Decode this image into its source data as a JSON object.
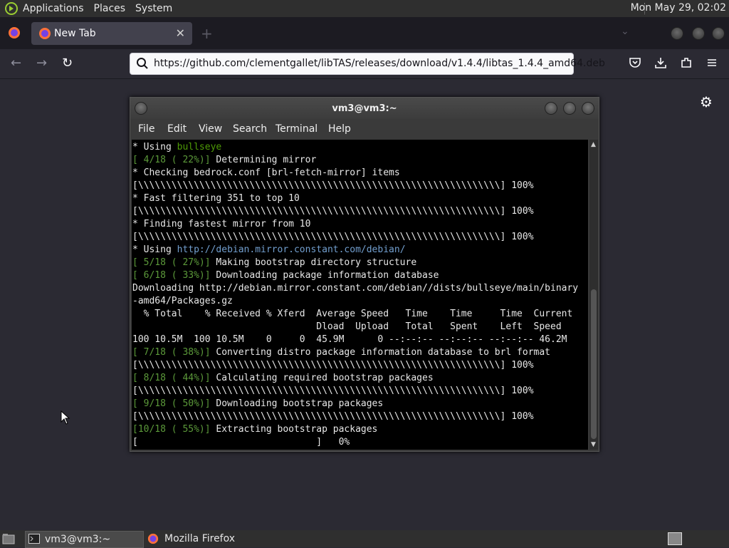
{
  "top_panel": {
    "menus": [
      "Applications",
      "Places",
      "System"
    ],
    "clock": "Mon May 29, 02:02"
  },
  "browser": {
    "tab": {
      "title": "New Tab",
      "close": "✕"
    },
    "new_tab": "+",
    "url": "https://github.com/clementgallet/libTAS/releases/download/v1.4.4/libtas_1.4.4_amd64.deb"
  },
  "terminal": {
    "title": "vm3@vm3:~",
    "menu": [
      "File",
      "Edit",
      "View",
      "Search",
      "Terminal",
      "Help"
    ],
    "lines": [
      [
        {
          "t": "* Using ",
          "c": ""
        },
        {
          "t": "bullseye",
          "c": "g"
        }
      ],
      [
        {
          "t": "[ 4/18 ( 22%)]",
          "c": "g2"
        },
        {
          "t": " Determining mirror",
          "c": ""
        }
      ],
      [
        {
          "t": "* Checking bedrock.conf [brl-fetch-mirror] items",
          "c": ""
        }
      ],
      [
        {
          "t": "[\\\\\\\\\\\\\\\\\\\\\\\\\\\\\\\\\\\\\\\\\\\\\\\\\\\\\\\\\\\\\\\\\\\\\\\\\\\\\\\\\\\\\\\\\\\\\\\\\\\\\\\\\\\\\\\\\\\\\\\\\\\\\\\\\\] 100%",
          "c": ""
        }
      ],
      [
        {
          "t": "* Fast filtering 351 to top 10",
          "c": ""
        }
      ],
      [
        {
          "t": "[\\\\\\\\\\\\\\\\\\\\\\\\\\\\\\\\\\\\\\\\\\\\\\\\\\\\\\\\\\\\\\\\\\\\\\\\\\\\\\\\\\\\\\\\\\\\\\\\\\\\\\\\\\\\\\\\\\\\\\\\\\\\\\\\\\] 100%",
          "c": ""
        }
      ],
      [
        {
          "t": "* Finding fastest mirror from 10",
          "c": ""
        }
      ],
      [
        {
          "t": "[\\\\\\\\\\\\\\\\\\\\\\\\\\\\\\\\\\\\\\\\\\\\\\\\\\\\\\\\\\\\\\\\\\\\\\\\\\\\\\\\\\\\\\\\\\\\\\\\\\\\\\\\\\\\\\\\\\\\\\\\\\\\\\\\\\] 100%",
          "c": ""
        }
      ],
      [
        {
          "t": "* Using ",
          "c": ""
        },
        {
          "t": "http://debian.mirror.constant.com/debian/",
          "c": "link"
        }
      ],
      [
        {
          "t": "[ 5/18 ( 27%)]",
          "c": "g2"
        },
        {
          "t": " Making bootstrap directory structure",
          "c": ""
        }
      ],
      [
        {
          "t": "[ 6/18 ( 33%)]",
          "c": "g2"
        },
        {
          "t": " Downloading package information database",
          "c": ""
        }
      ],
      [
        {
          "t": "Downloading http://debian.mirror.constant.com/debian//dists/bullseye/main/binary",
          "c": ""
        }
      ],
      [
        {
          "t": "-amd64/Packages.gz",
          "c": ""
        }
      ],
      [
        {
          "t": "  % Total    % Received % Xferd  Average Speed   Time    Time     Time  Current",
          "c": ""
        }
      ],
      [
        {
          "t": "                                 Dload  Upload   Total   Spent    Left  Speed",
          "c": ""
        }
      ],
      [
        {
          "t": "100 10.5M  100 10.5M    0     0  45.9M      0 --:--:-- --:--:-- --:--:-- 46.2M",
          "c": ""
        }
      ],
      [
        {
          "t": "[ 7/18 ( 38%)]",
          "c": "g2"
        },
        {
          "t": " Converting distro package information database to brl format",
          "c": ""
        }
      ],
      [
        {
          "t": "[\\\\\\\\\\\\\\\\\\\\\\\\\\\\\\\\\\\\\\\\\\\\\\\\\\\\\\\\\\\\\\\\\\\\\\\\\\\\\\\\\\\\\\\\\\\\\\\\\\\\\\\\\\\\\\\\\\\\\\\\\\\\\\\\\\] 100%",
          "c": ""
        }
      ],
      [
        {
          "t": "[ 8/18 ( 44%)]",
          "c": "g2"
        },
        {
          "t": " Calculating required bootstrap packages",
          "c": ""
        }
      ],
      [
        {
          "t": "[\\\\\\\\\\\\\\\\\\\\\\\\\\\\\\\\\\\\\\\\\\\\\\\\\\\\\\\\\\\\\\\\\\\\\\\\\\\\\\\\\\\\\\\\\\\\\\\\\\\\\\\\\\\\\\\\\\\\\\\\\\\\\\\\\\] 100%",
          "c": ""
        }
      ],
      [
        {
          "t": "[ 9/18 ( 50%)]",
          "c": "g2"
        },
        {
          "t": " Downloading bootstrap packages",
          "c": ""
        }
      ],
      [
        {
          "t": "[\\\\\\\\\\\\\\\\\\\\\\\\\\\\\\\\\\\\\\\\\\\\\\\\\\\\\\\\\\\\\\\\\\\\\\\\\\\\\\\\\\\\\\\\\\\\\\\\\\\\\\\\\\\\\\\\\\\\\\\\\\\\\\\\\\] 100%",
          "c": ""
        }
      ],
      [
        {
          "t": "[10/18 ( 55%)]",
          "c": "g2"
        },
        {
          "t": " Extracting bootstrap packages",
          "c": ""
        }
      ],
      [
        {
          "t": "[                                ]   0%",
          "c": ""
        }
      ]
    ]
  },
  "taskbar": {
    "items": [
      {
        "label": "vm3@vm3:~",
        "icon": "terminal-icon",
        "active": true
      },
      {
        "label": "Mozilla Firefox",
        "icon": "firefox-icon",
        "active": false
      }
    ]
  },
  "colors": {
    "accent_green": "#4e9a06",
    "link_blue": "#729fcf",
    "terminal_bg": "#000000"
  }
}
